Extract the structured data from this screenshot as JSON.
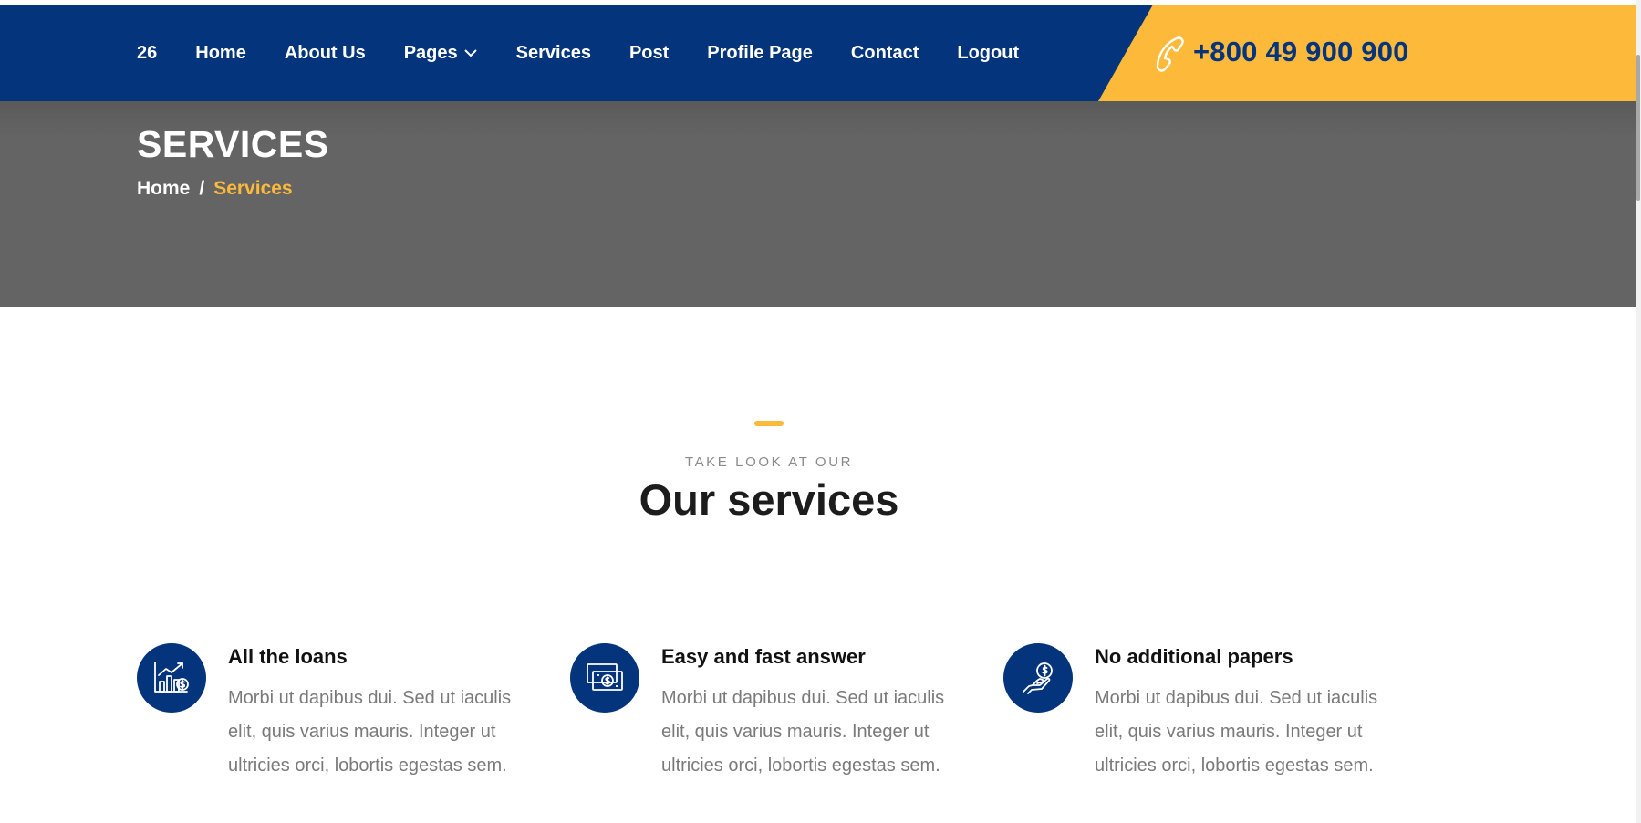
{
  "header": {
    "nav": {
      "item_26": "26",
      "home": "Home",
      "about": "About Us",
      "pages": "Pages",
      "services": "Services",
      "post": "Post",
      "profile": "Profile Page",
      "contact": "Contact",
      "logout": "Logout"
    },
    "phone_number": "+800 49 900 900",
    "phone_icon": "phone-icon"
  },
  "banner": {
    "title": "SERVICES",
    "breadcrumb": {
      "home": "Home",
      "separator": "/",
      "current": "Services"
    }
  },
  "services_section": {
    "kicker": "TAKE LOOK AT OUR",
    "title": "Our services",
    "items": [
      {
        "icon": "chart-growth-icon",
        "title": "All the loans",
        "text": "Morbi ut dapibus dui. Sed ut iaculis elit, quis varius mauris. Integer ut ultricies orci, lobortis egestas sem."
      },
      {
        "icon": "money-bill-icon",
        "title": "Easy and fast answer",
        "text": "Morbi ut dapibus dui. Sed ut iaculis elit, quis varius mauris. Integer ut ultricies orci, lobortis egestas sem."
      },
      {
        "icon": "hand-coin-icon",
        "title": "No additional papers",
        "text": "Morbi ut dapibus dui. Sed ut iaculis elit, quis varius mauris. Integer ut ultricies orci, lobortis egestas sem."
      }
    ]
  },
  "colors": {
    "brand_blue": "#04347b",
    "accent_yellow": "#fdb93a",
    "banner_gray": "#646464"
  }
}
